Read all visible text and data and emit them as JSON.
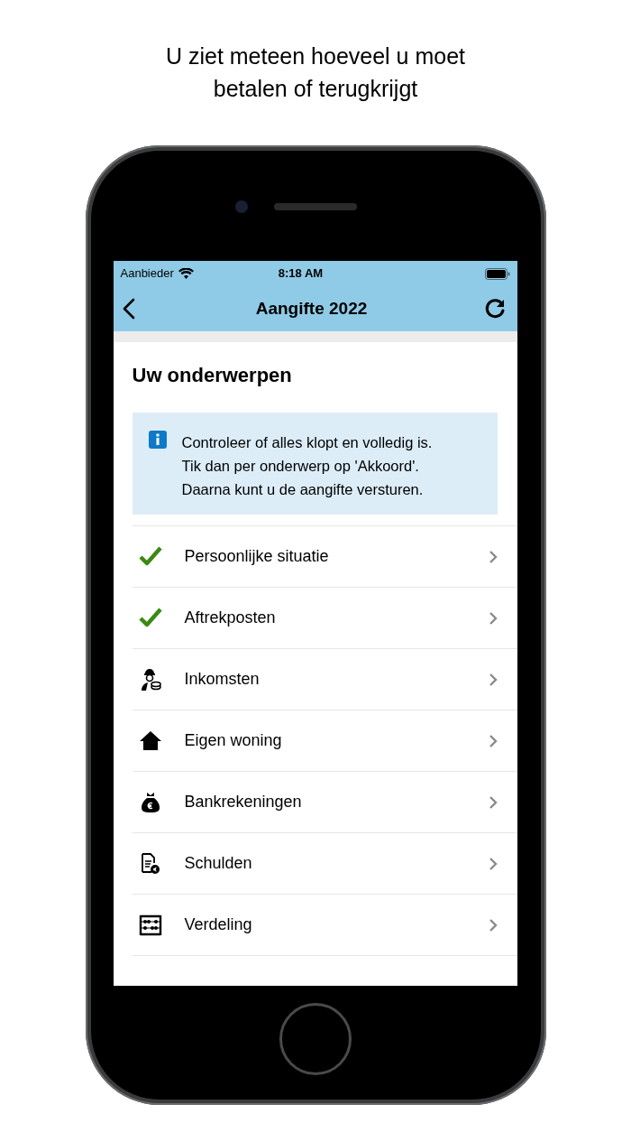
{
  "caption": "U ziet meteen hoeveel u moet betalen of terugkrijgt",
  "status_bar": {
    "carrier": "Aanbieder",
    "time": "8:18 AM"
  },
  "nav_bar": {
    "title": "Aangifte 2022"
  },
  "section_title": "Uw onderwerpen",
  "info": {
    "lines": [
      "Controleer of alles klopt en volledig is.",
      "Tik dan per onderwerp op 'Akkoord'.",
      "Daarna kunt u de aangifte versturen."
    ]
  },
  "topics": [
    {
      "kind": "done",
      "label": "Persoonlijke situatie"
    },
    {
      "kind": "done",
      "label": "Aftrekposten"
    },
    {
      "kind": "income",
      "label": "Inkomsten"
    },
    {
      "kind": "home",
      "label": "Eigen woning"
    },
    {
      "kind": "bank",
      "label": "Bankrekeningen"
    },
    {
      "kind": "debt",
      "label": "Schulden"
    },
    {
      "kind": "split",
      "label": "Verdeling"
    }
  ]
}
